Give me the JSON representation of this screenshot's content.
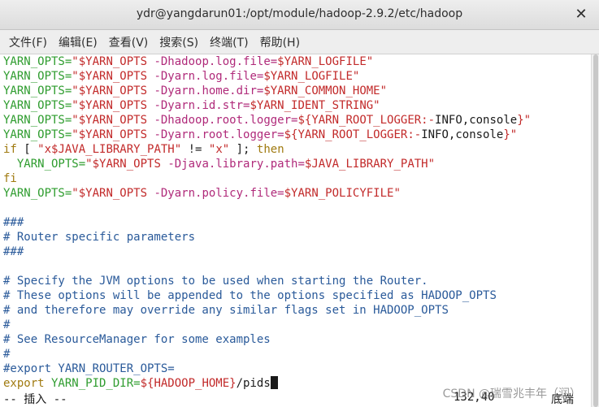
{
  "window": {
    "title": "ydr@yangdarun01:/opt/module/hadoop-2.9.2/etc/hadoop",
    "close_glyph": "✕"
  },
  "menu": [
    "文件(F)",
    "编辑(E)",
    "查看(V)",
    "搜索(S)",
    "终端(T)",
    "帮助(H)"
  ],
  "lines": [
    [
      [
        "YARN_OPTS=",
        "green"
      ],
      [
        "\"$YARN_OPTS ",
        "red"
      ],
      [
        "-Dhadoop.log.file=",
        "magenta"
      ],
      [
        "$YARN_LOGFILE\"",
        "red"
      ]
    ],
    [
      [
        "YARN_OPTS=",
        "green"
      ],
      [
        "\"$YARN_OPTS ",
        "red"
      ],
      [
        "-Dyarn.log.file=",
        "magenta"
      ],
      [
        "$YARN_LOGFILE\"",
        "red"
      ]
    ],
    [
      [
        "YARN_OPTS=",
        "green"
      ],
      [
        "\"$YARN_OPTS ",
        "red"
      ],
      [
        "-Dyarn.home.dir=",
        "magenta"
      ],
      [
        "$YARN_COMMON_HOME\"",
        "red"
      ]
    ],
    [
      [
        "YARN_OPTS=",
        "green"
      ],
      [
        "\"$YARN_OPTS ",
        "red"
      ],
      [
        "-Dyarn.id.str=",
        "magenta"
      ],
      [
        "$YARN_IDENT_STRING\"",
        "red"
      ]
    ],
    [
      [
        "YARN_OPTS=",
        "green"
      ],
      [
        "\"$YARN_OPTS ",
        "red"
      ],
      [
        "-Dhadoop.root.logger=",
        "magenta"
      ],
      [
        "${YARN_ROOT_LOGGER:-",
        "red"
      ],
      [
        "INFO,console",
        "dark"
      ],
      [
        "}\"",
        "red"
      ]
    ],
    [
      [
        "YARN_OPTS=",
        "green"
      ],
      [
        "\"$YARN_OPTS ",
        "red"
      ],
      [
        "-Dyarn.root.logger=",
        "magenta"
      ],
      [
        "${YARN_ROOT_LOGGER:-",
        "red"
      ],
      [
        "INFO,console",
        "dark"
      ],
      [
        "}\"",
        "red"
      ]
    ],
    [
      [
        "if",
        "olive"
      ],
      [
        " [ ",
        "dark"
      ],
      [
        "\"x$JAVA_LIBRARY_PATH\"",
        "red"
      ],
      [
        " != ",
        "dark"
      ],
      [
        "\"x\"",
        "red"
      ],
      [
        " ]; ",
        "dark"
      ],
      [
        "then",
        "olive"
      ]
    ],
    [
      [
        "  YARN_OPTS=",
        "green"
      ],
      [
        "\"$YARN_OPTS ",
        "red"
      ],
      [
        "-Djava.library.path=",
        "magenta"
      ],
      [
        "$JAVA_LIBRARY_PATH\"",
        "red"
      ]
    ],
    [
      [
        "fi",
        "olive"
      ]
    ],
    [
      [
        "YARN_OPTS=",
        "green"
      ],
      [
        "\"$YARN_OPTS ",
        "red"
      ],
      [
        "-Dyarn.policy.file=",
        "magenta"
      ],
      [
        "$YARN_POLICYFILE\"",
        "red"
      ]
    ],
    [],
    [
      [
        "###",
        "blue"
      ]
    ],
    [
      [
        "# Router specific parameters",
        "blue"
      ]
    ],
    [
      [
        "###",
        "blue"
      ]
    ],
    [],
    [
      [
        "# Specify the JVM options to be used when starting the Router.",
        "blue"
      ]
    ],
    [
      [
        "# These options will be appended to the options specified as HADOOP_OPTS",
        "blue"
      ]
    ],
    [
      [
        "# and therefore may override any similar flags set in HADOOP_OPTS",
        "blue"
      ]
    ],
    [
      [
        "#",
        "blue"
      ]
    ],
    [
      [
        "# See ResourceManager for some examples",
        "blue"
      ]
    ],
    [
      [
        "#",
        "blue"
      ]
    ],
    [
      [
        "#export YARN_ROUTER_OPTS=",
        "blue"
      ]
    ],
    [
      [
        "export",
        "olive"
      ],
      [
        " YARN_PID_DIR=",
        "green"
      ],
      [
        "${HADOOP_HOME}",
        "red"
      ],
      [
        "/pids",
        "dark"
      ]
    ]
  ],
  "status": {
    "mode": "-- 插入 --",
    "position": "132,40",
    "scroll": "底端"
  },
  "watermark": "CSDN @瑞雪兆丰年（润）"
}
